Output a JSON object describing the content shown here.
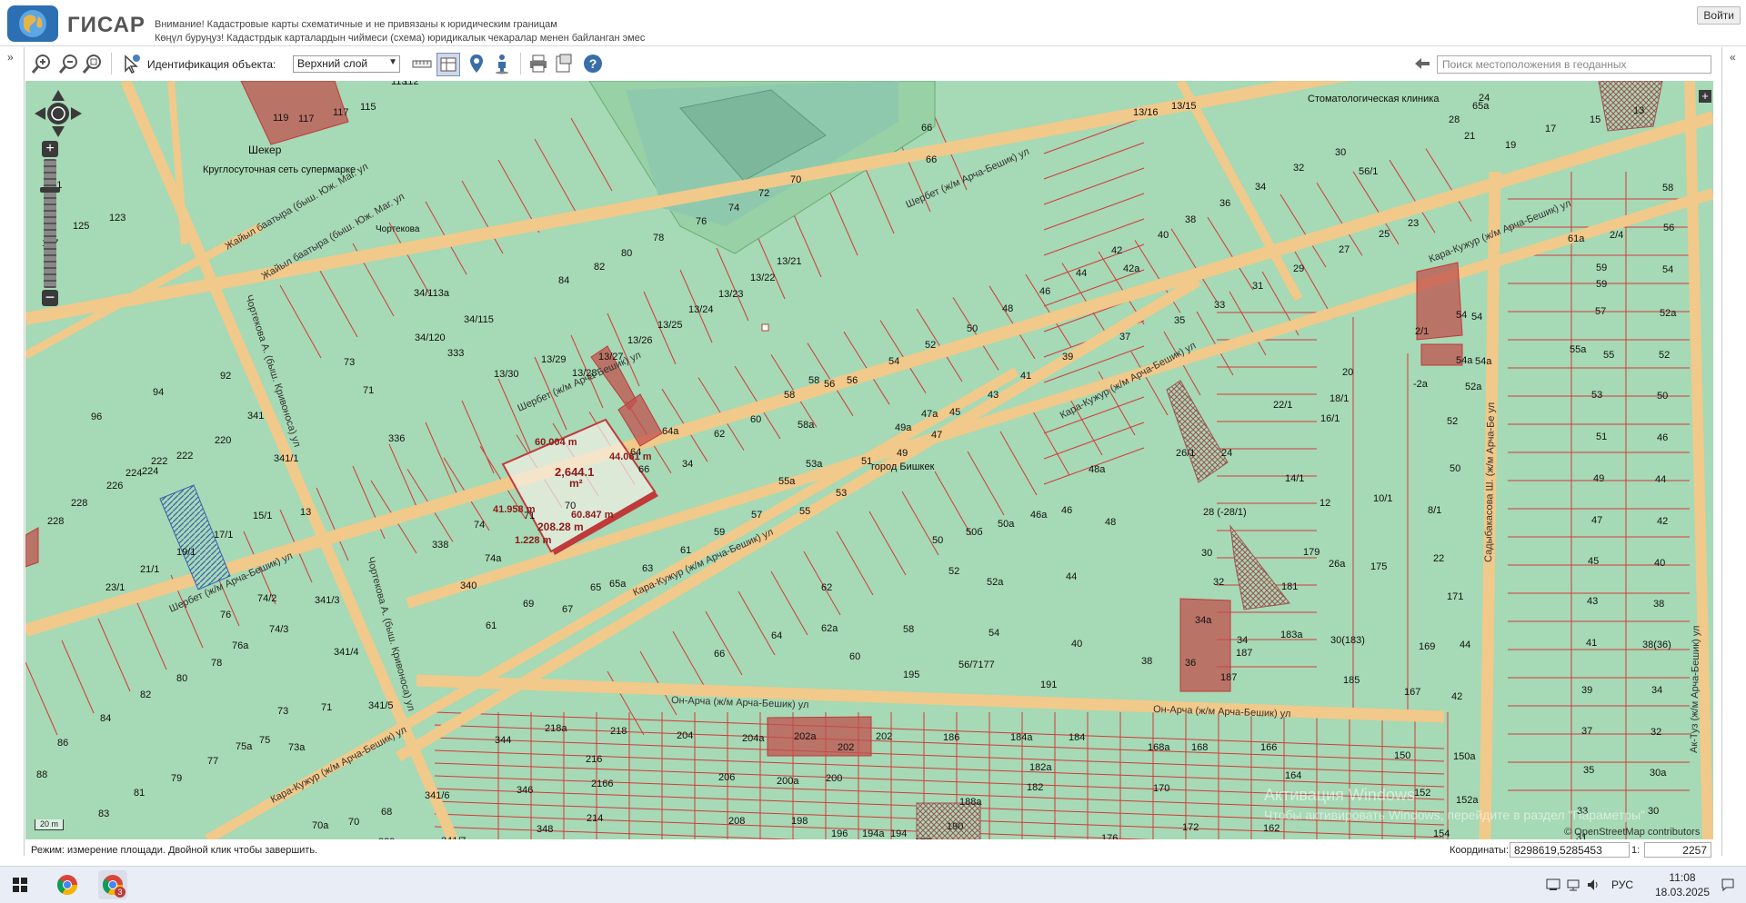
{
  "header": {
    "app_title": "ГИСАР",
    "warning_ru": "Внимание! Кадастровые карты схематичные и не привязаны к юридическим границам",
    "warning_ky": "Көңүл буруңуз! Кадастрдык карталардын чиймеси (схема) юридикалык чекаралар менен байланган эмес",
    "login_label": "Войти"
  },
  "toolbar": {
    "ident_label": "Идентификация объекта:",
    "layer_value": "Верхний слой",
    "search_placeholder": "Поиск местоположения в геоданных",
    "icons": [
      "zoom-in-icon",
      "zoom-out-icon",
      "zoom-extent-icon",
      "identify-icon",
      "measure-length-icon",
      "measure-area-icon",
      "location-pin-icon",
      "person-icon",
      "print-icon",
      "export-icon",
      "help-icon",
      "back-icon"
    ]
  },
  "map": {
    "streets": [
      "Жайыл баатыра (быш. Юж. Маг. ул",
      "Жайыл баатыра (быш. Юж. Маг. ул",
      "Шербет (ж/м Арча-Бешик) ул",
      "Шербет (ж/м Арча-Бешик) ул",
      "Шербет (ж/м Арча-Бешик) ул",
      "Кара-Кужур (ж/м Арча-Бешик) ул",
      "Кара-Кужур (ж/м Арча-Бешик) ул",
      "Кара-Кужур (ж/м Арча-Бешик) ул",
      "Кара-Кужур (ж/м Арча-Бешик) ул",
      "Он-Арча (ж/м Арча-Бешик) ул",
      "Он-Арча (ж/м Арча-Бешик) ул",
      "Чортекова А. (быш. Кривоноса) ул",
      "Чортекова А. (быш. Кривоноса) ул",
      "Садыбакасова Ш. (ж/м Арча-Бе ул",
      "Ак-Туз (ж/м Арча-Бешик) ул"
    ],
    "pois": [
      "Шекер",
      "Круглосуточная сеть супермарке",
      "город Бишкек",
      "Стоматологическая клиника",
      "Чортекова"
    ],
    "measure": {
      "area": "2,644.1",
      "area_unit": "m²",
      "edges": [
        "60.004 m",
        "44.061 m",
        "41.958 m",
        "60.847 m",
        "208.28 m",
        "1.228 m"
      ]
    },
    "attribution": "© OpenStreetMap contributors",
    "scale_bar": "20 m",
    "watermark_1": "Активация Windows",
    "watermark_2": "Чтобы активировать Windows, перейдите в раздел \"Параметры\""
  },
  "status": {
    "mode_text": "Режим: измерение площади. Двойной клик чтобы завершить.",
    "coords_label": "Координаты:",
    "coords_value": "8298619,5285453",
    "scale_label": "1:",
    "scale_value": "2257"
  },
  "taskbar": {
    "lang": "РУС",
    "time": "11:08",
    "date": "18.03.2025",
    "chrome_badge": "3"
  },
  "colors": {
    "map_bg": "#a6d9b5",
    "parcel_line": "#d23a3a",
    "road": "#f1c98a",
    "highlight": "#c0504d"
  }
}
